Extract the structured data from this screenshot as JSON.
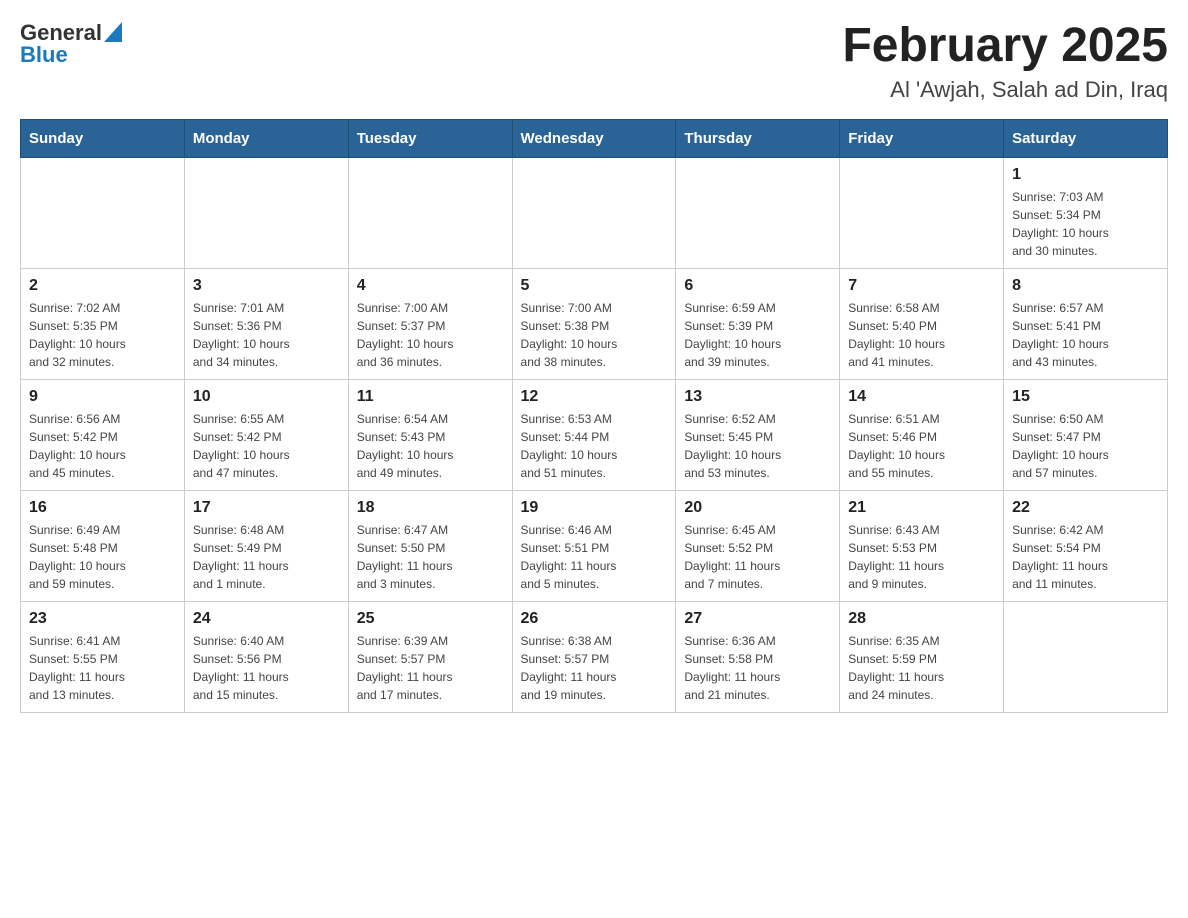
{
  "header": {
    "logo_general": "General",
    "logo_blue": "Blue",
    "month_title": "February 2025",
    "location": "Al 'Awjah, Salah ad Din, Iraq"
  },
  "weekdays": [
    "Sunday",
    "Monday",
    "Tuesday",
    "Wednesday",
    "Thursday",
    "Friday",
    "Saturday"
  ],
  "weeks": [
    [
      {
        "day": "",
        "info": ""
      },
      {
        "day": "",
        "info": ""
      },
      {
        "day": "",
        "info": ""
      },
      {
        "day": "",
        "info": ""
      },
      {
        "day": "",
        "info": ""
      },
      {
        "day": "",
        "info": ""
      },
      {
        "day": "1",
        "info": "Sunrise: 7:03 AM\nSunset: 5:34 PM\nDaylight: 10 hours\nand 30 minutes."
      }
    ],
    [
      {
        "day": "2",
        "info": "Sunrise: 7:02 AM\nSunset: 5:35 PM\nDaylight: 10 hours\nand 32 minutes."
      },
      {
        "day": "3",
        "info": "Sunrise: 7:01 AM\nSunset: 5:36 PM\nDaylight: 10 hours\nand 34 minutes."
      },
      {
        "day": "4",
        "info": "Sunrise: 7:00 AM\nSunset: 5:37 PM\nDaylight: 10 hours\nand 36 minutes."
      },
      {
        "day": "5",
        "info": "Sunrise: 7:00 AM\nSunset: 5:38 PM\nDaylight: 10 hours\nand 38 minutes."
      },
      {
        "day": "6",
        "info": "Sunrise: 6:59 AM\nSunset: 5:39 PM\nDaylight: 10 hours\nand 39 minutes."
      },
      {
        "day": "7",
        "info": "Sunrise: 6:58 AM\nSunset: 5:40 PM\nDaylight: 10 hours\nand 41 minutes."
      },
      {
        "day": "8",
        "info": "Sunrise: 6:57 AM\nSunset: 5:41 PM\nDaylight: 10 hours\nand 43 minutes."
      }
    ],
    [
      {
        "day": "9",
        "info": "Sunrise: 6:56 AM\nSunset: 5:42 PM\nDaylight: 10 hours\nand 45 minutes."
      },
      {
        "day": "10",
        "info": "Sunrise: 6:55 AM\nSunset: 5:42 PM\nDaylight: 10 hours\nand 47 minutes."
      },
      {
        "day": "11",
        "info": "Sunrise: 6:54 AM\nSunset: 5:43 PM\nDaylight: 10 hours\nand 49 minutes."
      },
      {
        "day": "12",
        "info": "Sunrise: 6:53 AM\nSunset: 5:44 PM\nDaylight: 10 hours\nand 51 minutes."
      },
      {
        "day": "13",
        "info": "Sunrise: 6:52 AM\nSunset: 5:45 PM\nDaylight: 10 hours\nand 53 minutes."
      },
      {
        "day": "14",
        "info": "Sunrise: 6:51 AM\nSunset: 5:46 PM\nDaylight: 10 hours\nand 55 minutes."
      },
      {
        "day": "15",
        "info": "Sunrise: 6:50 AM\nSunset: 5:47 PM\nDaylight: 10 hours\nand 57 minutes."
      }
    ],
    [
      {
        "day": "16",
        "info": "Sunrise: 6:49 AM\nSunset: 5:48 PM\nDaylight: 10 hours\nand 59 minutes."
      },
      {
        "day": "17",
        "info": "Sunrise: 6:48 AM\nSunset: 5:49 PM\nDaylight: 11 hours\nand 1 minute."
      },
      {
        "day": "18",
        "info": "Sunrise: 6:47 AM\nSunset: 5:50 PM\nDaylight: 11 hours\nand 3 minutes."
      },
      {
        "day": "19",
        "info": "Sunrise: 6:46 AM\nSunset: 5:51 PM\nDaylight: 11 hours\nand 5 minutes."
      },
      {
        "day": "20",
        "info": "Sunrise: 6:45 AM\nSunset: 5:52 PM\nDaylight: 11 hours\nand 7 minutes."
      },
      {
        "day": "21",
        "info": "Sunrise: 6:43 AM\nSunset: 5:53 PM\nDaylight: 11 hours\nand 9 minutes."
      },
      {
        "day": "22",
        "info": "Sunrise: 6:42 AM\nSunset: 5:54 PM\nDaylight: 11 hours\nand 11 minutes."
      }
    ],
    [
      {
        "day": "23",
        "info": "Sunrise: 6:41 AM\nSunset: 5:55 PM\nDaylight: 11 hours\nand 13 minutes."
      },
      {
        "day": "24",
        "info": "Sunrise: 6:40 AM\nSunset: 5:56 PM\nDaylight: 11 hours\nand 15 minutes."
      },
      {
        "day": "25",
        "info": "Sunrise: 6:39 AM\nSunset: 5:57 PM\nDaylight: 11 hours\nand 17 minutes."
      },
      {
        "day": "26",
        "info": "Sunrise: 6:38 AM\nSunset: 5:57 PM\nDaylight: 11 hours\nand 19 minutes."
      },
      {
        "day": "27",
        "info": "Sunrise: 6:36 AM\nSunset: 5:58 PM\nDaylight: 11 hours\nand 21 minutes."
      },
      {
        "day": "28",
        "info": "Sunrise: 6:35 AM\nSunset: 5:59 PM\nDaylight: 11 hours\nand 24 minutes."
      },
      {
        "day": "",
        "info": ""
      }
    ]
  ]
}
